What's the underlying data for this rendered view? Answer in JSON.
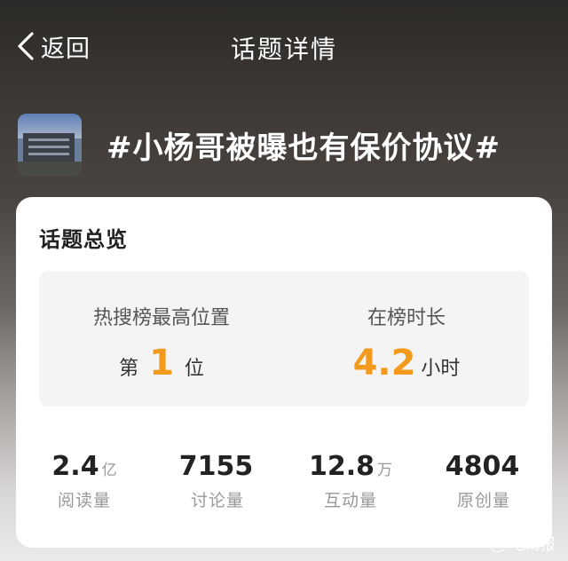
{
  "header": {
    "back_label": "返回",
    "title": "话题详情"
  },
  "topic": {
    "image_icon": "topic-thumbnail-building",
    "title": "#小杨哥被曝也有保价协议#"
  },
  "overview": {
    "title": "话题总览",
    "highest_rank": {
      "label": "热搜榜最高位置",
      "prefix": "第",
      "value": "1",
      "suffix": "位"
    },
    "duration": {
      "label": "在榜时长",
      "value": "4.2",
      "unit": "小时"
    },
    "accent_color": "#f39a1a",
    "metrics": [
      {
        "value": "2.4",
        "unit": "亿",
        "label": "阅读量"
      },
      {
        "value": "7155",
        "unit": "",
        "label": "讨论量"
      },
      {
        "value": "12.8",
        "unit": "万",
        "label": "互动量"
      },
      {
        "value": "4804",
        "unit": "",
        "label": "原创量"
      }
    ]
  },
  "watermark": {
    "text": "电商报",
    "icon": "watermark-logo-icon"
  }
}
